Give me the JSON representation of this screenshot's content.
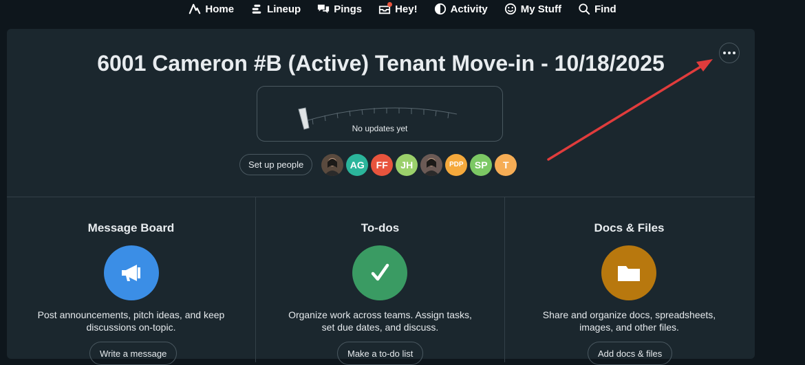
{
  "nav": {
    "items": [
      {
        "label": "Home",
        "icon": "basecamp-logo-icon"
      },
      {
        "label": "Lineup",
        "icon": "lineup-icon"
      },
      {
        "label": "Pings",
        "icon": "chat-bubbles-icon"
      },
      {
        "label": "Hey!",
        "icon": "inbox-icon"
      },
      {
        "label": "Activity",
        "icon": "activity-icon"
      },
      {
        "label": "My Stuff",
        "icon": "smiley-icon"
      },
      {
        "label": "Find",
        "icon": "search-icon"
      }
    ]
  },
  "project": {
    "title": "6001 Cameron #B (Active) Tenant Move-in - 10/18/2025",
    "hill_status": "No updates yet",
    "setup_people_label": "Set up people",
    "avatars": [
      {
        "initials": "",
        "color": "#5a4a3e",
        "kind": "photo"
      },
      {
        "initials": "AG",
        "color": "#2bb59b"
      },
      {
        "initials": "FF",
        "color": "#e8543d"
      },
      {
        "initials": "JH",
        "color": "#9bd06b"
      },
      {
        "initials": "",
        "color": "#6b5a55",
        "kind": "photo"
      },
      {
        "initials": "PDP",
        "color": "#f5a93c"
      },
      {
        "initials": "SP",
        "color": "#7cc864"
      },
      {
        "initials": "T",
        "color": "#f6ad55"
      }
    ]
  },
  "tools": [
    {
      "title": "Message Board",
      "description": "Post announcements, pitch ideas, and keep discussions on-topic.",
      "button": "Write a message",
      "color": "#3b8ee6",
      "icon": "megaphone-icon"
    },
    {
      "title": "To-dos",
      "description": "Organize work across teams. Assign tasks, set due dates, and discuss.",
      "button": "Make a to-do list",
      "color": "#3a9b63",
      "icon": "checkmark-icon"
    },
    {
      "title": "Docs & Files",
      "description": "Share and organize docs, spreadsheets, images, and other files.",
      "button": "Add docs & files",
      "color": "#b8780e",
      "icon": "folder-icon"
    }
  ]
}
